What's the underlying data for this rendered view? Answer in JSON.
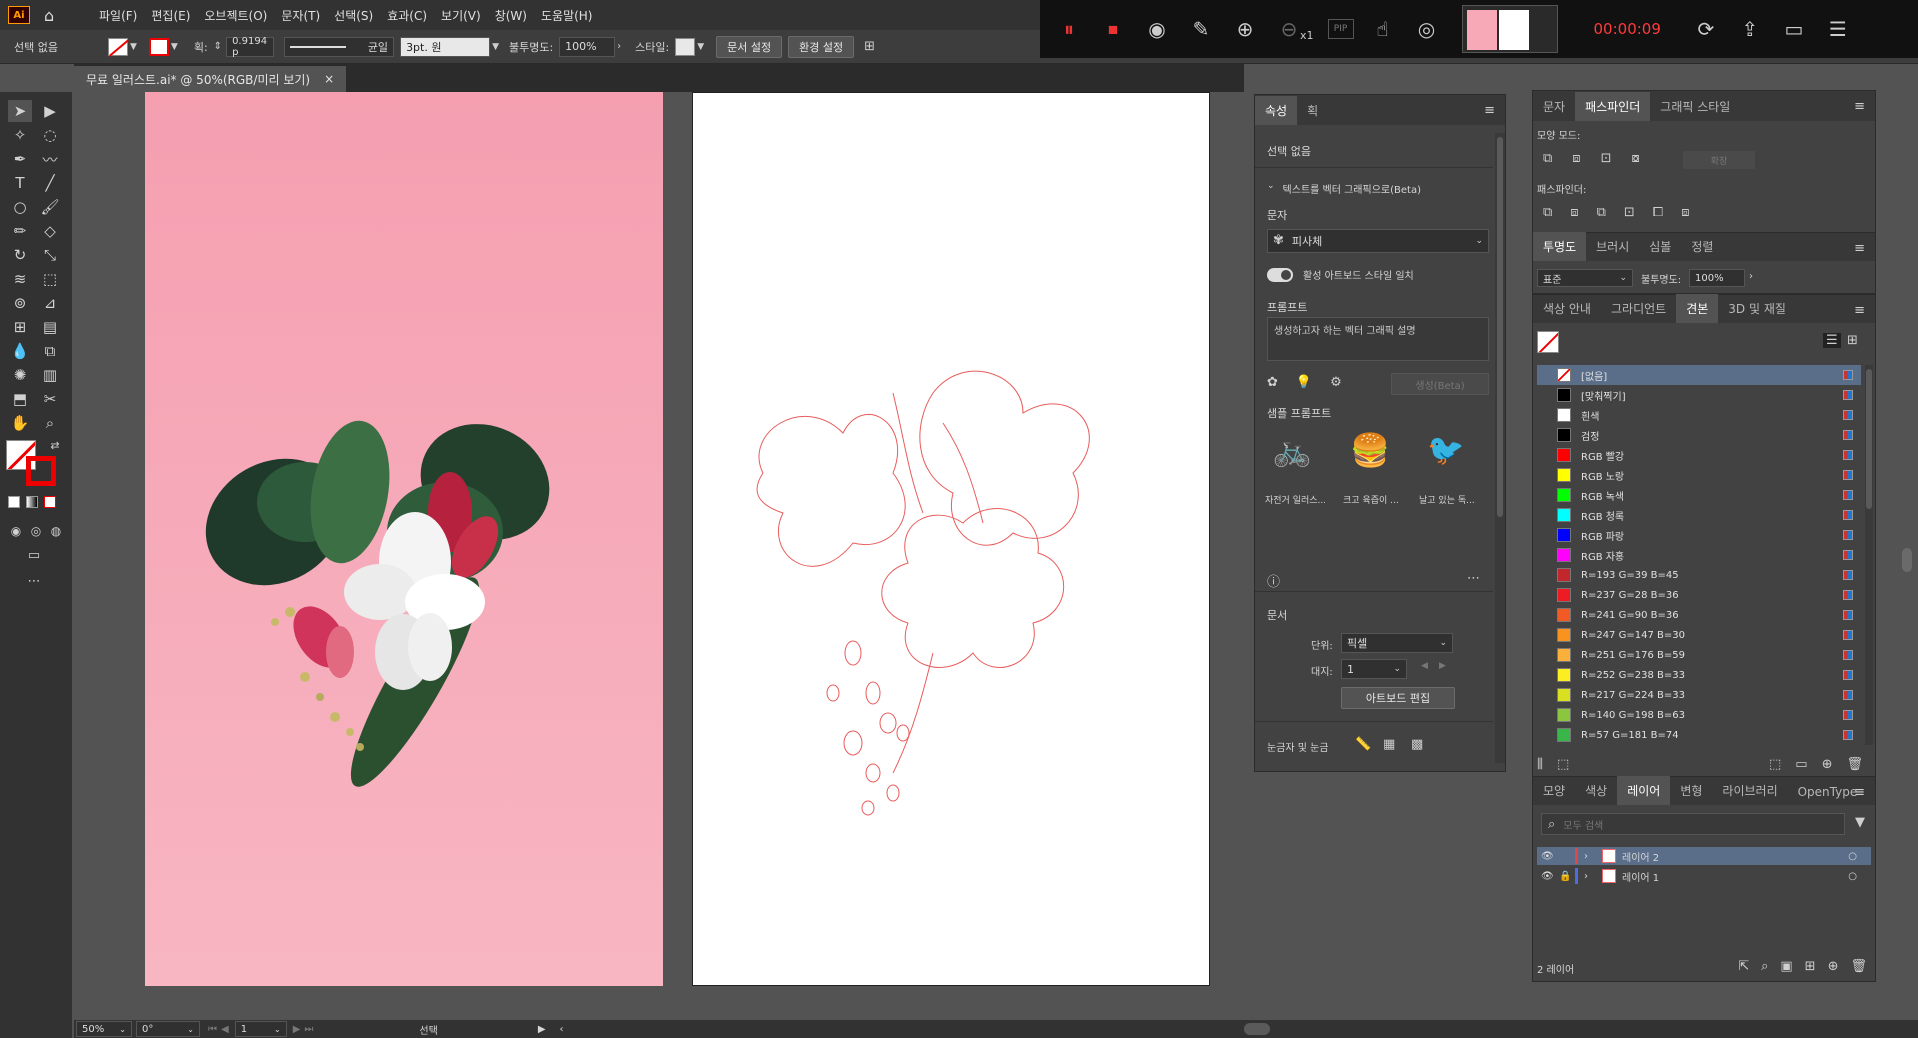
{
  "app": {
    "logo": "Ai",
    "home_icon": "home-icon"
  },
  "menu": [
    "파일(F)",
    "편집(E)",
    "오브젝트(O)",
    "문자(T)",
    "선택(S)",
    "효과(C)",
    "보기(V)",
    "창(W)",
    "도움말(H)"
  ],
  "control": {
    "selection": "선택 없음",
    "stroke_label": "획:",
    "stroke_value": "0.9194 p",
    "profile_label": "균일",
    "brush_value": "3pt. 원",
    "opacity_label": "불투명도:",
    "opacity_value": "100%",
    "style_label": "스타일:",
    "doc_setup": "문서 설정",
    "prefs": "환경 설정"
  },
  "recorder": {
    "timer": "00:00:09",
    "zoom": "x1",
    "pip": "PIP"
  },
  "document_tab": {
    "title": "무료 일러스트.ai* @ 50%(RGB/미리 보기)",
    "close": "×"
  },
  "properties": {
    "tabs": [
      "속성",
      "획"
    ],
    "none_selected": "선택 없음",
    "t2v_title": "텍스트를 벡터 그래픽으로(Beta)",
    "type_label": "문자",
    "type_value": "피사체",
    "match_style": "활성 아트보드 스타일 일치",
    "prompt_label": "프롬프트",
    "prompt_placeholder": "생성하고자 하는 벡터 그래픽 설명",
    "generate": "생성(Beta)",
    "samples_label": "샘플 프롬프트",
    "samples": [
      "자전거 일러스...",
      "크고 육즙이 ...",
      "날고 있는 독..."
    ],
    "doc_label": "문서",
    "unit_label": "단위:",
    "unit_value": "픽셀",
    "artboard_label": "대지:",
    "artboard_value": "1",
    "edit_artboard": "아트보드 편집",
    "rulers_label": "눈금자 및 눈금"
  },
  "pathfinder": {
    "tabs": [
      "문자",
      "패스파인더",
      "그래픽 스타일"
    ],
    "shape_modes": "모양 모드:",
    "expand": "확장",
    "pathfinders": "패스파인더:"
  },
  "transparency": {
    "tabs": [
      "투명도",
      "브러시",
      "심볼",
      "정렬"
    ],
    "mode": "표준",
    "opacity_label": "불투명도:",
    "opacity_value": "100%"
  },
  "swatches": {
    "tabs": [
      "색상 안내",
      "그라디언트",
      "견본",
      "3D 및 재질"
    ],
    "items": [
      {
        "name": "[없음]",
        "color": "none"
      },
      {
        "name": "[맞춰찍기]",
        "color": "#000000"
      },
      {
        "name": "흰색",
        "color": "#ffffff"
      },
      {
        "name": "검정",
        "color": "#000000"
      },
      {
        "name": "RGB 빨강",
        "color": "#ff0000"
      },
      {
        "name": "RGB 노랑",
        "color": "#ffff00"
      },
      {
        "name": "RGB 녹색",
        "color": "#00ff00"
      },
      {
        "name": "RGB 청록",
        "color": "#00ffff"
      },
      {
        "name": "RGB 파랑",
        "color": "#0000ff"
      },
      {
        "name": "RGB 자홍",
        "color": "#ff00ff"
      },
      {
        "name": "R=193 G=39 B=45",
        "color": "#c1272d"
      },
      {
        "name": "R=237 G=28 B=36",
        "color": "#ed1c24"
      },
      {
        "name": "R=241 G=90 B=36",
        "color": "#f15a24"
      },
      {
        "name": "R=247 G=147 B=30",
        "color": "#f7931e"
      },
      {
        "name": "R=251 G=176 B=59",
        "color": "#fbb03b"
      },
      {
        "name": "R=252 G=238 B=33",
        "color": "#fcee21"
      },
      {
        "name": "R=217 G=224 B=33",
        "color": "#d9e021"
      },
      {
        "name": "R=140 G=198 B=63",
        "color": "#8cc63f"
      },
      {
        "name": "R=57 G=181 B=74",
        "color": "#39b54a"
      }
    ]
  },
  "layers": {
    "tabs": [
      "모양",
      "색상",
      "레이어",
      "변형",
      "라이브러리",
      "OpenType"
    ],
    "search_placeholder": "모두 검색",
    "items": [
      {
        "name": "레이어 2",
        "color": "#e04848",
        "selected": true
      },
      {
        "name": "레이어 1",
        "color": "#4a6ee0",
        "selected": false
      }
    ],
    "count": "2 레이어"
  },
  "status": {
    "zoom": "50%",
    "rotation": "0°",
    "artboard": "1",
    "tool": "선택"
  }
}
